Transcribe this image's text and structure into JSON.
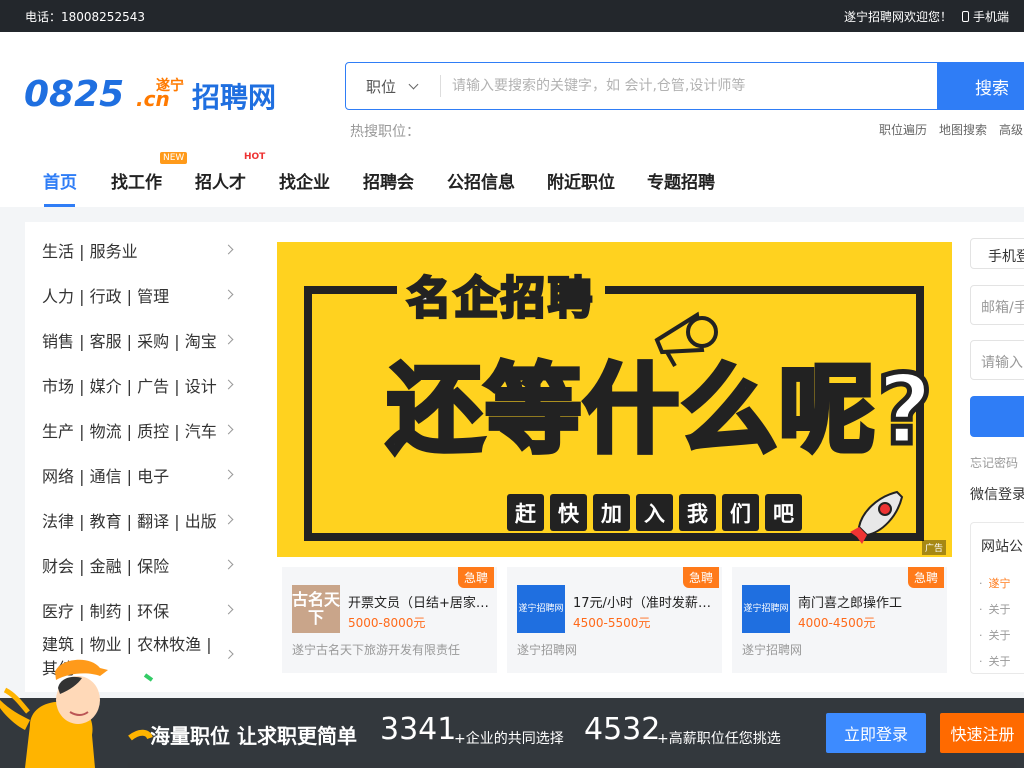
{
  "topbar": {
    "phone": "电话：18008252543",
    "welcome": "遂宁招聘网欢迎您！",
    "mobile": "手机端"
  },
  "logo": {
    "text_main": "0825",
    "text_suffix": ".cn",
    "text_city": "遂宁",
    "text_brand": "招聘网"
  },
  "search": {
    "select_label": "职位",
    "placeholder": "请输入要搜索的关键字，如 会计,仓管,设计师等",
    "value": "",
    "button": "搜索"
  },
  "hot_label": "热搜职位：",
  "header_links": [
    "职位遍历",
    "地图搜索",
    "高级"
  ],
  "nav": {
    "items": [
      "首页",
      "找工作",
      "招人才",
      "找企业",
      "招聘会",
      "公招信息",
      "附近职位",
      "专题招聘"
    ],
    "badge_new": "NEW",
    "badge_hot": "HOT"
  },
  "categories": [
    "生活 | 服务业",
    "人力 | 行政 | 管理",
    "销售 | 客服 | 采购 | 淘宝",
    "市场 | 媒介 | 广告 | 设计",
    "生产 | 物流 | 质控 | 汽车",
    "网络 | 通信 | 电子",
    "法律 | 教育 | 翻译 | 出版",
    "财会 | 金融 | 保险",
    "医疗 | 制药 | 环保",
    "建筑 | 物业 | 农林牧渔 | 其他"
  ],
  "banner": {
    "title": "名企招聘",
    "headline": "还等什么呢?",
    "cta_chars": [
      "赶",
      "快",
      "加",
      "入",
      "我",
      "们",
      "吧"
    ],
    "ad": "广告"
  },
  "jobs": [
    {
      "urgent": "急聘",
      "logo": "古名天下",
      "title": "开票文员（日结+居家…",
      "salary": "5000-8000元",
      "company": "遂宁古名天下旅游开发有限责任"
    },
    {
      "urgent": "急聘",
      "logo": "遂宁招聘网",
      "title": "17元/小时（准时发薪/…",
      "salary": "4500-5500元",
      "company": "遂宁招聘网"
    },
    {
      "urgent": "急聘",
      "logo": "遂宁招聘网",
      "title": "南门喜之郎操作工",
      "salary": "4000-4500元",
      "company": "遂宁招聘网"
    }
  ],
  "login": {
    "tab": "手机登",
    "field1": "邮箱/手",
    "field2": "请输入",
    "forgot": "忘记密码",
    "wechat": "微信登录"
  },
  "notice": {
    "title": "网站公",
    "items": [
      "遂宁",
      "关于",
      "关于",
      "关于"
    ]
  },
  "bottom": {
    "slogan": "海量职位 让求职更简单",
    "count1": "3341",
    "desc1": "+企业的共同选择",
    "count2": "4532",
    "desc2": "+高薪职位任您挑选",
    "login": "立即登录",
    "register": "快速注册"
  },
  "colors": {
    "accent": "#2f7df6",
    "orange": "#ff7a1a",
    "dark": "#23272c",
    "banner_yellow": "#ffd21f"
  }
}
